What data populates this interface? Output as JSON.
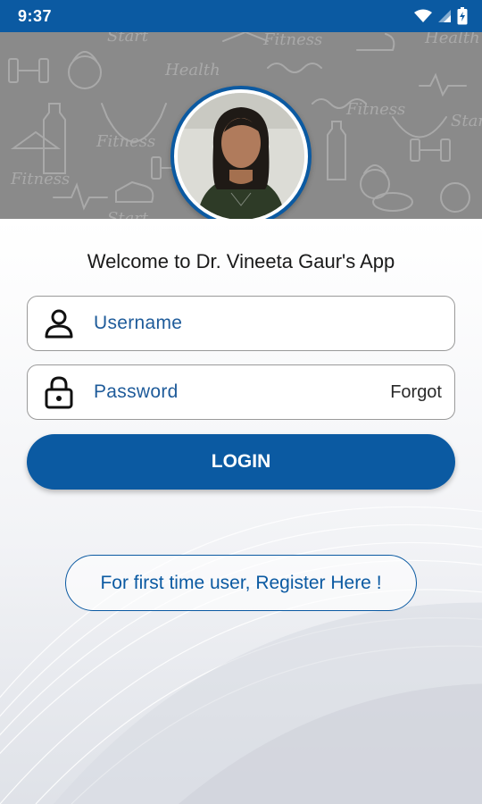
{
  "status_bar": {
    "time": "9:37",
    "icons": [
      "wifi-icon",
      "signal-icon",
      "battery-icon"
    ]
  },
  "header": {
    "doodle_words": [
      "Start",
      "Fitness",
      "Health",
      "Fitness",
      "Start",
      "Fitness",
      "Health",
      "Start",
      "Fitness"
    ]
  },
  "welcome_text": "Welcome to Dr. Vineeta Gaur's App",
  "username": {
    "placeholder": "Username",
    "value": ""
  },
  "password": {
    "placeholder": "Password",
    "value": "",
    "forgot_label": "Forgot"
  },
  "login_label": "LOGIN",
  "register_label": "For first time user, Register Here !",
  "colors": {
    "primary": "#0b5aa2",
    "header_bg": "#8a8a8a"
  }
}
